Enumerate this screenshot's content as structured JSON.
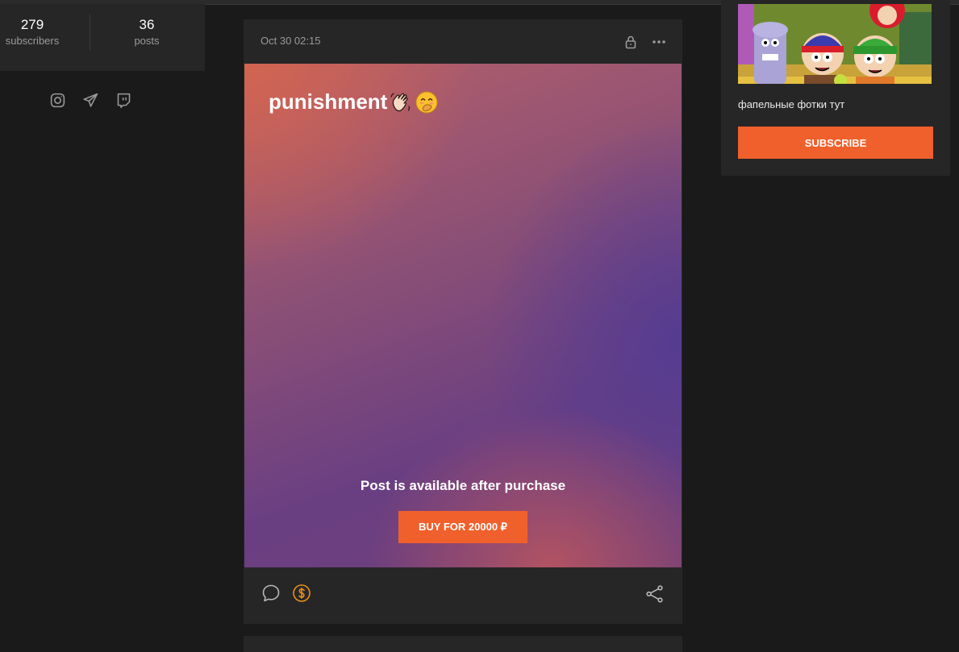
{
  "profile": {
    "stats": [
      {
        "value": "279",
        "label": "subscribers"
      },
      {
        "value": "36",
        "label": "posts"
      }
    ],
    "socials": [
      "instagram-icon",
      "telegram-icon",
      "twitch-icon"
    ]
  },
  "post": {
    "date": "Oct 30 02:15",
    "title": "punishment",
    "title_emojis": [
      "waving-hand-emoji",
      "face-hand-over-mouth-emoji"
    ],
    "locked_message": "Post is available after purchase",
    "buy_label": "BUY FOR 20000 ₽",
    "footer_icons": [
      "comment-icon",
      "donate-icon",
      "share-icon"
    ]
  },
  "sidebar": {
    "widget_text": "фапельные фотки тут",
    "subscribe_label": "SUBSCRIBE"
  },
  "colors": {
    "accent": "#f0602c",
    "background": "#1a1a1a",
    "card": "#262626",
    "muted_text": "#9a9a9a",
    "donate": "#e8901a"
  }
}
